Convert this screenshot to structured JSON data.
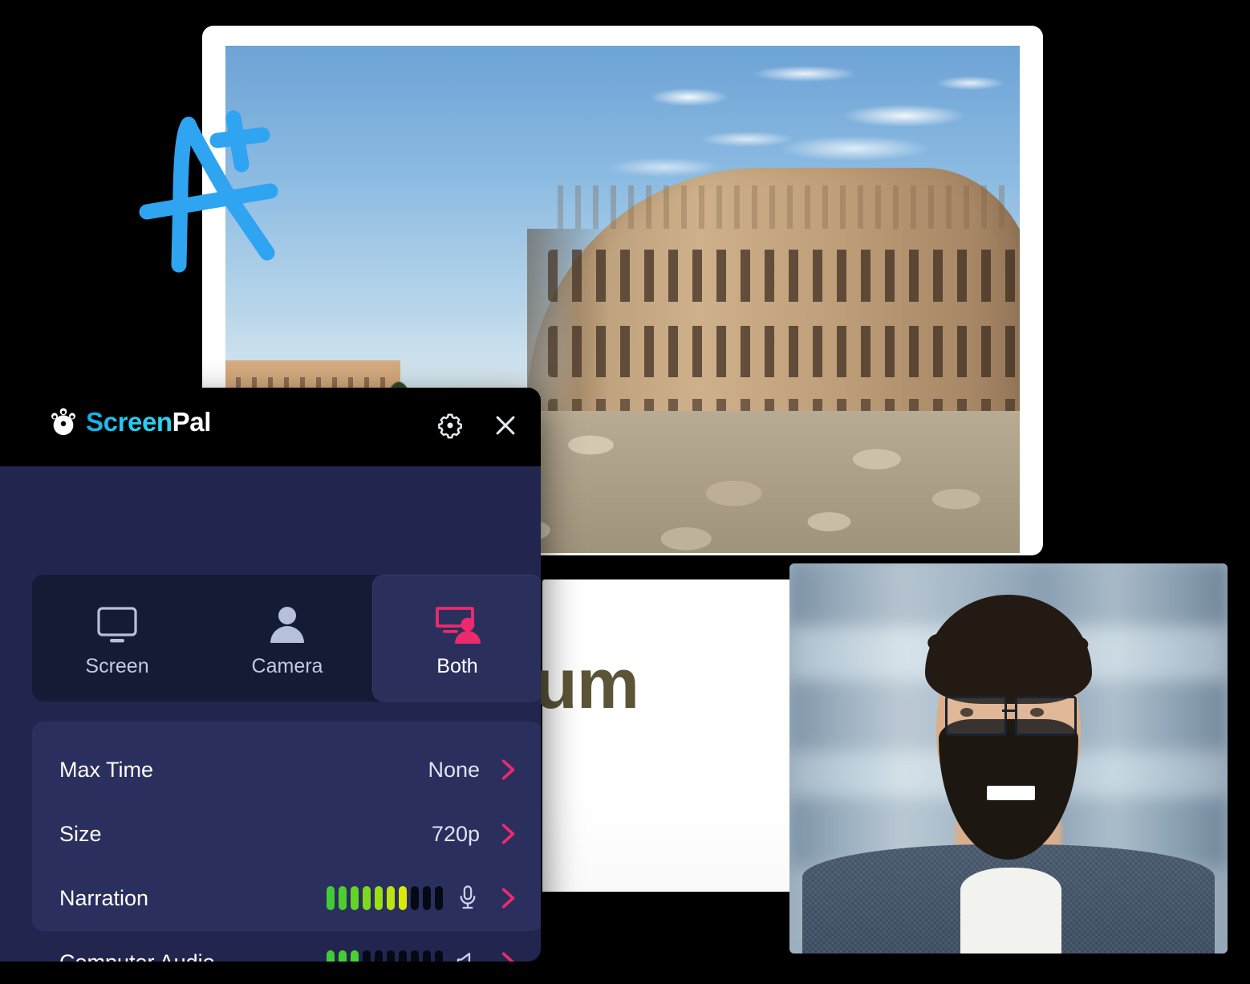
{
  "app": {
    "brand_primary": "ScreenPal",
    "brand_part1": "Screen",
    "brand_part2": "Pal",
    "accent_pink": "#ee2a6e",
    "accent_cyan": "#22c5ef",
    "panel_bg": "#22264e",
    "header_bg": "#000000"
  },
  "header": {
    "settings_icon": "gear-icon",
    "close_icon": "close-icon",
    "logo_icon": "screenpal-logo-icon"
  },
  "tabs": [
    {
      "label": "Screen",
      "icon": "monitor-icon",
      "selected": false
    },
    {
      "label": "Camera",
      "icon": "person-icon",
      "selected": false
    },
    {
      "label": "Both",
      "icon": "monitor-person-icon",
      "selected": true
    }
  ],
  "settings_rows": [
    {
      "label": "Max Time",
      "value": "None",
      "type": "value",
      "chevron": "chevron-right-icon"
    },
    {
      "label": "Size",
      "value": "720p",
      "type": "value",
      "chevron": "chevron-right-icon"
    },
    {
      "label": "Narration",
      "type": "meter",
      "icon": "microphone-icon",
      "meter": {
        "total": 10,
        "lit": 7,
        "colors": [
          "#3fcc35",
          "#4ccf2e",
          "#62d425",
          "#7ed91e",
          "#9ade17",
          "#bde40f",
          "#dbe908"
        ]
      },
      "chevron": "chevron-right-icon"
    },
    {
      "label": "Computer Audio",
      "type": "meter",
      "icon": "speaker-icon",
      "meter": {
        "total": 10,
        "lit": 3,
        "colors": [
          "#3fcc35",
          "#44ce32",
          "#4ad02f"
        ]
      },
      "chevron": "chevron-right-icon"
    }
  ],
  "canvas": {
    "slide_photo_alt": "colosseum-sunrise-photo",
    "annotation": "a-plus-doodle",
    "annotation_color": "#2fa4f0",
    "text_slide_headline": "um",
    "text_slide_headline_color": "#5b5437",
    "webcam_alt": "webcam-presenter-video"
  }
}
